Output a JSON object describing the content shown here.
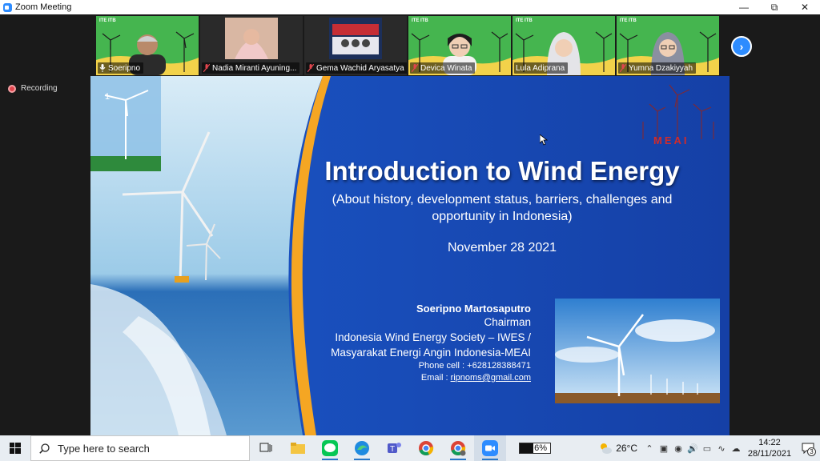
{
  "window": {
    "title": "Zoom Meeting"
  },
  "participants": [
    {
      "name": "Soeripno",
      "muted": false,
      "tag": "ITE ITB",
      "active": true
    },
    {
      "name": "Nadia Miranti Ayuning...",
      "muted": true
    },
    {
      "name": "Gema Wachid Aryasatya",
      "muted": true
    },
    {
      "name": "Devica Winata",
      "muted": true,
      "tag": "ITE ITB"
    },
    {
      "name": "Lula Adiprana",
      "muted": false,
      "tag": "ITE ITB"
    },
    {
      "name": "Yumna Dzakiyyah",
      "muted": true,
      "tag": "ITE ITB"
    }
  ],
  "recording": {
    "label": "Recording"
  },
  "slide": {
    "page": "1",
    "title": "Introduction to Wind Energy",
    "subtitle_line1": "(About history, development status, barriers, challenges and",
    "subtitle_line2": "opportunity in Indonesia)",
    "date": "November 28 2021",
    "presenter_name": "Soeripno Martosaputro",
    "presenter_role": "Chairman",
    "org_line1": "Indonesia Wind Energy Society – IWES /",
    "org_line2": "Masyarakat  Energi Angin Indonesia-MEAI",
    "phone": "Phone cell : +628128388471",
    "email_label": "Email    : ",
    "email": "ripnoms@gmail.com",
    "logo_text": "MEAI"
  },
  "taskbar": {
    "search_placeholder": "Type here to search",
    "battery_percent": "6%",
    "temperature": "26°C",
    "time": "14:22",
    "date": "28/11/2021",
    "notification_count": "3"
  },
  "colors": {
    "zoom_blue": "#2d8cff",
    "slide_blue": "#1948b8",
    "orange_arc": "#f5a623",
    "active_speaker": "#7ed321"
  }
}
